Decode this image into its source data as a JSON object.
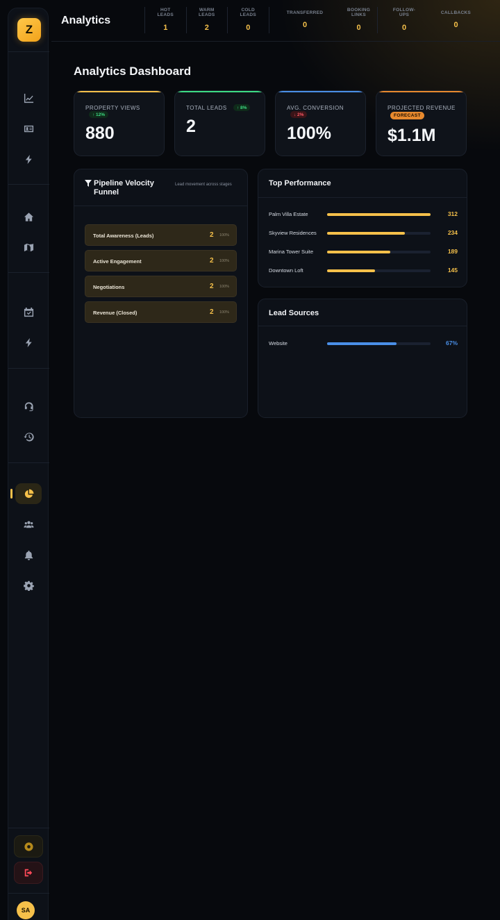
{
  "app": {
    "logo_letter": "Z",
    "page_title": "Analytics",
    "user_initials": "SA"
  },
  "header_kpis": [
    {
      "label": "HOT LEADS",
      "value": "1"
    },
    {
      "label": "WARM LEADS",
      "value": "2"
    },
    {
      "label": "COLD LEADS",
      "value": "0"
    },
    {
      "label": "TRANSFERRED",
      "value": "0"
    },
    {
      "label": "BOOKING LINKS",
      "value": "0"
    },
    {
      "label": "FOLLOW-UPS",
      "value": "0"
    },
    {
      "label": "CALLBACKS",
      "value": "0"
    }
  ],
  "sidebar": {
    "icons": [
      "chart-line-icon",
      "id-card-icon",
      "bolt-icon",
      "home-icon",
      "map-icon",
      "calendar-check-icon",
      "bolt-icon",
      "headset-icon",
      "history-icon",
      "pie-chart-icon",
      "users-icon",
      "bell-icon",
      "gear-icon"
    ],
    "active": "pie-chart-icon"
  },
  "dashboard": {
    "title": "Analytics Dashboard",
    "stats": [
      {
        "label": "PROPERTY VIEWS",
        "value": "880",
        "badge": "↑ 12%",
        "badge_type": "up",
        "accent": "#f5c04a"
      },
      {
        "label": "TOTAL LEADS",
        "value": "2",
        "badge": "↑ 8%",
        "badge_type": "up",
        "accent": "#3ddc84"
      },
      {
        "label": "AVG. CONVERSION",
        "value": "100%",
        "badge": "↓ 2%",
        "badge_type": "down",
        "accent": "#4a8fe7"
      },
      {
        "label": "PROJECTED REVENUE",
        "value": "$1.1M",
        "badge": "FORECAST",
        "badge_type": "forecast",
        "accent": "#e7892e"
      }
    ],
    "funnel": {
      "title": "Pipeline Velocity Funnel",
      "subtitle": "Lead movement across stages",
      "stages": [
        {
          "name": "Total Awareness (Leads)",
          "count": "2",
          "pct": "100%"
        },
        {
          "name": "Active Engagement",
          "count": "2",
          "pct": "100%"
        },
        {
          "name": "Negotiations",
          "count": "2",
          "pct": "100%"
        },
        {
          "name": "Revenue (Closed)",
          "count": "2",
          "pct": "100%"
        }
      ]
    },
    "top_performance": {
      "title": "Top Performance",
      "items": [
        {
          "name": "Palm Villa Estate",
          "value": "312",
          "fraction": 1.0
        },
        {
          "name": "Skyview Residences",
          "value": "234",
          "fraction": 0.75
        },
        {
          "name": "Marina Tower Suite",
          "value": "189",
          "fraction": 0.61
        },
        {
          "name": "Downtown Loft",
          "value": "145",
          "fraction": 0.46
        }
      ],
      "color": "#f5c04a"
    },
    "lead_sources": {
      "title": "Lead Sources",
      "items": [
        {
          "name": "Website",
          "value": "67%",
          "fraction": 0.67
        }
      ],
      "color": "#4a8fe7"
    }
  }
}
